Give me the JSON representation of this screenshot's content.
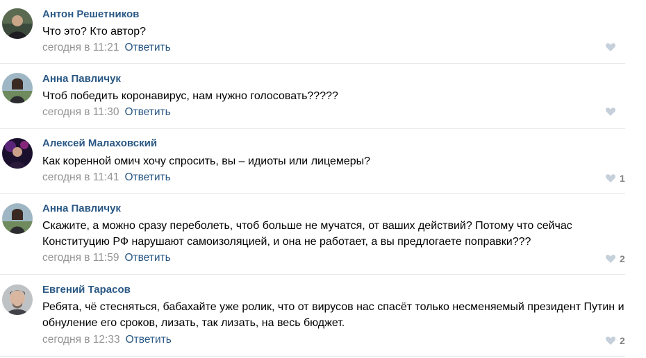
{
  "comments": [
    {
      "author": "Антон Решетников",
      "text": "Что это? Кто автор?",
      "date": "сегодня в 11:21",
      "reply_label": "Ответить",
      "likes": "",
      "avatar_icon": "user-avatar"
    },
    {
      "author": "Анна Павличук",
      "text": "Чтоб победить коронавирус, нам нужно голосовать?????",
      "date": "сегодня в 11:30",
      "reply_label": "Ответить",
      "likes": "",
      "avatar_icon": "user-avatar"
    },
    {
      "author": "Алексей Малаховский",
      "text": "Как коренной омич хочу спросить, вы – идиоты или лицемеры?",
      "date": "сегодня в 11:41",
      "reply_label": "Ответить",
      "likes": "1",
      "avatar_icon": "user-avatar"
    },
    {
      "author": "Анна Павличук",
      "text": "Скажите, а можно сразу переболеть, чтоб больше не мучатся, от ваших действий? Потому что сейчас Конституцию РФ нарушают самоизоляцией, и она не работает, а вы предлогаете поправки???",
      "date": "сегодня в 11:59",
      "reply_label": "Ответить",
      "likes": "2",
      "avatar_icon": "user-avatar"
    },
    {
      "author": "Евгений Тарасов",
      "text": "Ребята, чё стесняться, бабахайте уже ролик, что от вирусов нас спасёт только несменяемый президент Путин и обнуление его сроков, лизать, так лизать, на весь бюджет.",
      "date": "сегодня в 12:33",
      "reply_label": "Ответить",
      "likes": "2",
      "avatar_icon": "user-avatar"
    }
  ],
  "colors": {
    "author": "#2a5885",
    "date": "#939393",
    "reply": "#2a5885",
    "heart": "#c5d0db",
    "divider": "#e7e8ec"
  },
  "icons": {
    "like": "heart-icon"
  }
}
